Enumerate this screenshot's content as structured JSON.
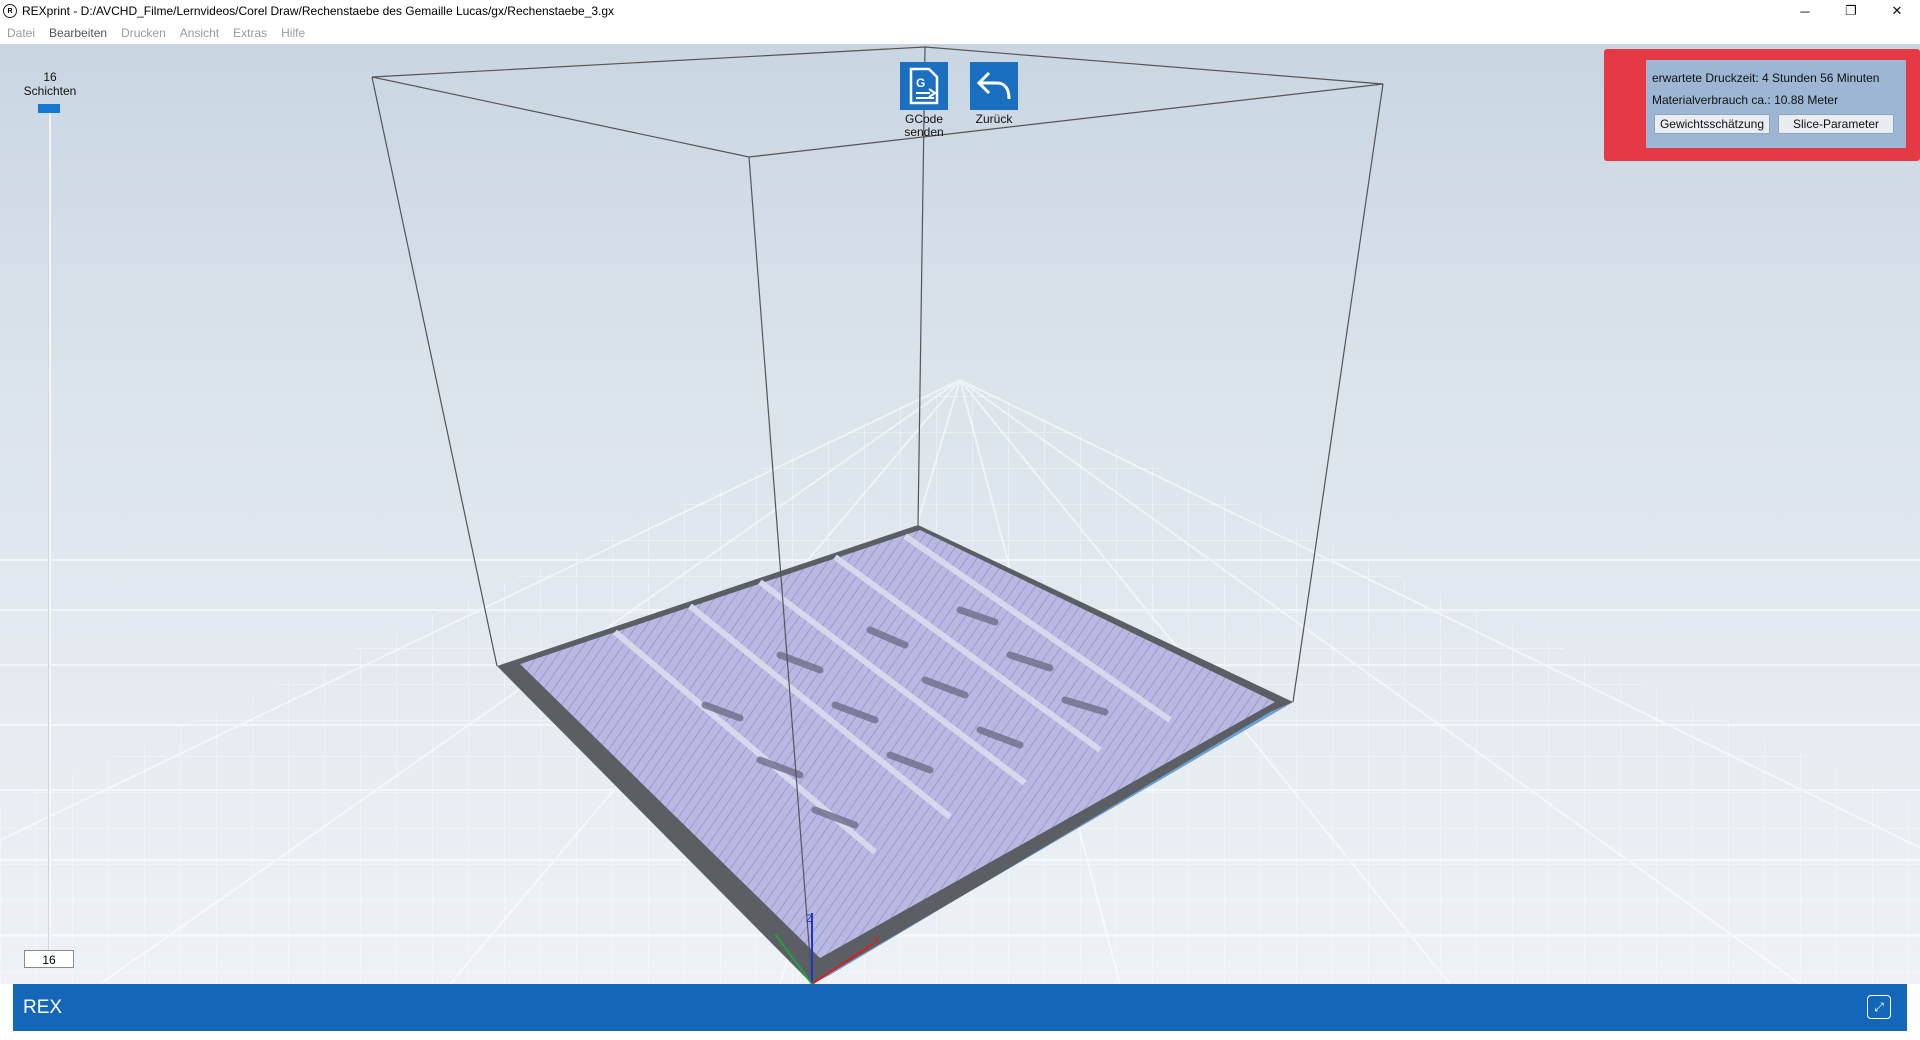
{
  "window": {
    "title": "REXprint - D:/AVCHD_Filme/Lernvideos/Corel Draw/Rechenstaebe des Gemaille Lucas/gx/Rechenstaebe_3.gx",
    "app_icon": "rex-logo-icon",
    "controls": [
      "minimize-icon",
      "restore-icon",
      "close-icon"
    ]
  },
  "menu": [
    "Datei",
    "Bearbeiten",
    "Drucken",
    "Ansicht",
    "Extras",
    "Hilfe"
  ],
  "layers": {
    "count_top": "16",
    "label": "Schichten",
    "current": "16"
  },
  "actions": {
    "gcode_line1": "GCode",
    "gcode_line2": "senden",
    "back": "Zurück"
  },
  "info": {
    "print_time_label": "erwartete Druckzeit:",
    "print_time_value": "4 Stunden 56 Minuten",
    "material_label": "Materialverbrauch ca.:",
    "material_value": "10.88 Meter",
    "weight_button": "Gewichtsschätzung",
    "slice_button": "Slice-Parameter"
  },
  "axes": {
    "z": "Z",
    "x": "X"
  },
  "bottom": {
    "label": "REX",
    "icon": "expand-link-icon"
  },
  "colors": {
    "accent": "#1466b8",
    "highlight": "#e53945",
    "model": "#b7b6e0",
    "plate_edge": "#5b5f63"
  }
}
